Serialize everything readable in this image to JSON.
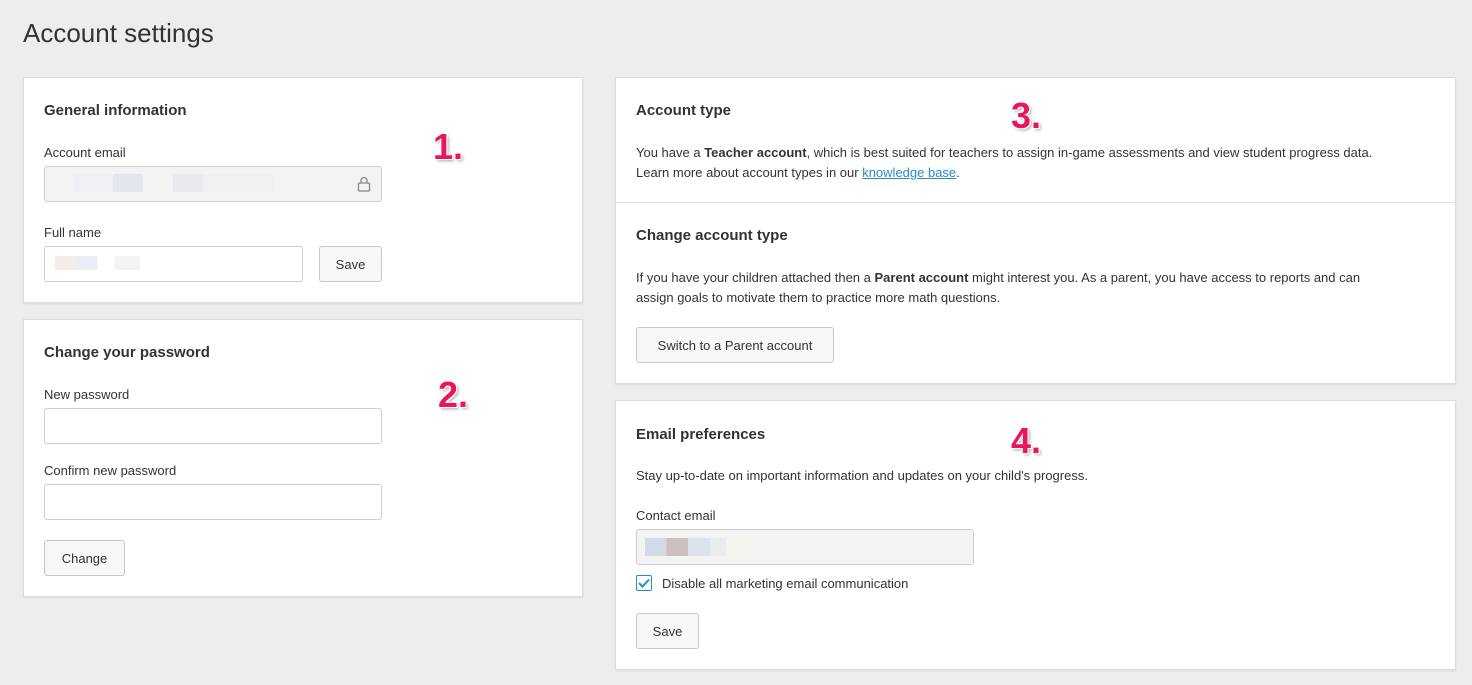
{
  "page": {
    "title": "Account settings"
  },
  "general": {
    "title": "General information",
    "email_label": "Account email",
    "fullname_label": "Full name",
    "save_label": "Save",
    "lock_icon": "lock-icon",
    "step": "1."
  },
  "password": {
    "title": "Change your password",
    "new_label": "New password",
    "confirm_label": "Confirm new password",
    "change_label": "Change",
    "step": "2."
  },
  "account_type": {
    "title": "Account type",
    "line1_pre": "You have a ",
    "line1_bold": "Teacher account",
    "line1_post": ", which is best suited for teachers to assign in-game assessments and view student progress data.",
    "line2_pre": "Learn more about account types in our ",
    "line2_link": "knowledge base",
    "line2_post": ".",
    "step": "3."
  },
  "change_type": {
    "title": "Change account type",
    "line1_pre": "If you have your children attached then a ",
    "line1_bold": "Parent account",
    "line1_post": " might interest you. As a parent, you have access to reports and can",
    "line2": "assign goals to motivate them to practice more math questions.",
    "button_label": "Switch to a Parent account"
  },
  "email_prefs": {
    "title": "Email preferences",
    "description": "Stay up-to-date on important information and updates on your child's progress.",
    "contact_label": "Contact email",
    "checkbox_label": "Disable all marketing email communication",
    "checkbox_checked": true,
    "save_label": "Save",
    "step": "4."
  },
  "colors": {
    "accent": "#2a8bc4",
    "step_marker": "#e8175d",
    "background": "#ededed"
  }
}
